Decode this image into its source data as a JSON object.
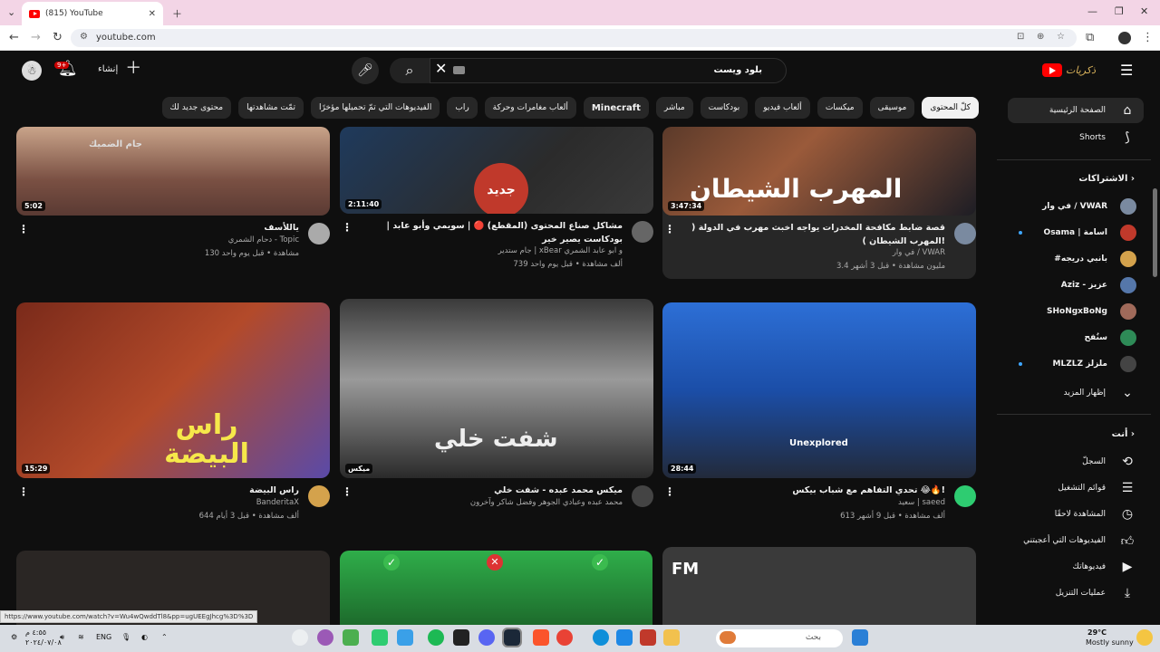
{
  "browser": {
    "tab_title": "(815) YouTube",
    "url": "youtube.com",
    "status_url": "https://www.youtube.com/watch?v=Wu4wQwddTl8&pp=ugUEEgJhcg%3D%3D"
  },
  "header": {
    "search_query": "بلود ويست",
    "create_label": "إنشاء",
    "notifications_badge": "9+",
    "logo_wordmark": "ذكريات",
    "brand_color": "#ff0000"
  },
  "chips": [
    {
      "label": "كلّ المحتوى",
      "active": true
    },
    {
      "label": "موسيقى"
    },
    {
      "label": "ميكسات"
    },
    {
      "label": "ألعاب فيديو"
    },
    {
      "label": "بودكاست"
    },
    {
      "label": "مباشر"
    },
    {
      "label": "Minecraft",
      "bold": true
    },
    {
      "label": "ألعاب مغامرات وحركة"
    },
    {
      "label": "راب"
    },
    {
      "label": "الفيديوهات التي تمّ تحميلها مؤخرًا"
    },
    {
      "label": "تمّت مشاهدتها"
    },
    {
      "label": "محتوى جديد لك"
    }
  ],
  "sidebar": {
    "home": "الصفحة الرئيسية",
    "shorts": "Shorts",
    "subscriptions_title": "الاشتراكات",
    "subscriptions": [
      {
        "name": "في وار / VWAR",
        "color": "#7a8aa0"
      },
      {
        "name": "Osama | اسامة",
        "color": "#c0392b",
        "dot": true
      },
      {
        "name": "#بانبي دريجه",
        "color": "#d4a24c"
      },
      {
        "name": "Aziz - عزيز",
        "color": "#5577aa"
      },
      {
        "name": "SHoNgxBoNg",
        "color": "#a06a5a"
      },
      {
        "name": "سنُفح",
        "color": "#2e8b57"
      },
      {
        "name": "MLZLZ ملزلز",
        "color": "#444",
        "dot": true
      }
    ],
    "show_more": "إظهار المزيد",
    "you_title": "أنت",
    "you_items": [
      "السجلّ",
      "قوائم التشغيل",
      "المشاهدة لاحقًا",
      "الفيديوهات التي أعجبتني",
      "فيديوهاتك",
      "عمليات التنزيل"
    ]
  },
  "videos": [
    {
      "title": "قصة ضابط مكافحة المخدرات يواجه اخبث مهرب في الدولة ( المهرب الشيطان )!",
      "channel": "في وار / VWAR",
      "stats": "3.4 مليون مشاهدة • قبل 3 أشهر",
      "duration": "3:47:34",
      "thumb_text": "المهرب الشيطان"
    },
    {
      "title": "مشاكل صناع المحتوى (المقطع) 🔴 | سويمي وأبو عابد | بودكاست يصير خير",
      "channel": "جام ستدير | xBear و ابو عابد الشمري",
      "stats": "739 ألف مشاهدة • قبل يوم واحد",
      "duration": "2:11:40",
      "thumb_text": "جديد"
    },
    {
      "title": "ياللأسف",
      "channel": "دحام الشمري - Topic",
      "stats": "130 مشاهدة • قبل يوم واحد",
      "duration": "5:02",
      "thumb_text": "جام الضميك"
    },
    {
      "title": "تحدي التفاهم مع شباب بيكس 😂🔥!",
      "channel": "سعيد | saeed",
      "stats": "613 ألف مشاهدة • قبل 9 أشهر",
      "duration": "28:44",
      "thumb_text": "Unexplored"
    },
    {
      "title": "ميكس محمد عبده - شفت خلي",
      "channel": "محمد عبده وعبادي الجوهر وفضل شاكر وآخرون",
      "stats": "",
      "duration": "ميكس",
      "thumb_text": "شفت خلي"
    },
    {
      "title": "راس البيضة",
      "channel": "BanderitaX",
      "stats": "644 ألف مشاهدة • قبل 3 أيام",
      "duration": "15:29",
      "thumb_text": "راس البيضة"
    }
  ],
  "taskbar": {
    "search": "بحث",
    "lang": "ENG",
    "weather_temp": "29°C",
    "weather_desc": "Mostly sunny",
    "time": "٤:٥٥ م",
    "date": "٢٠٢٤/٠٧/٠٨"
  }
}
